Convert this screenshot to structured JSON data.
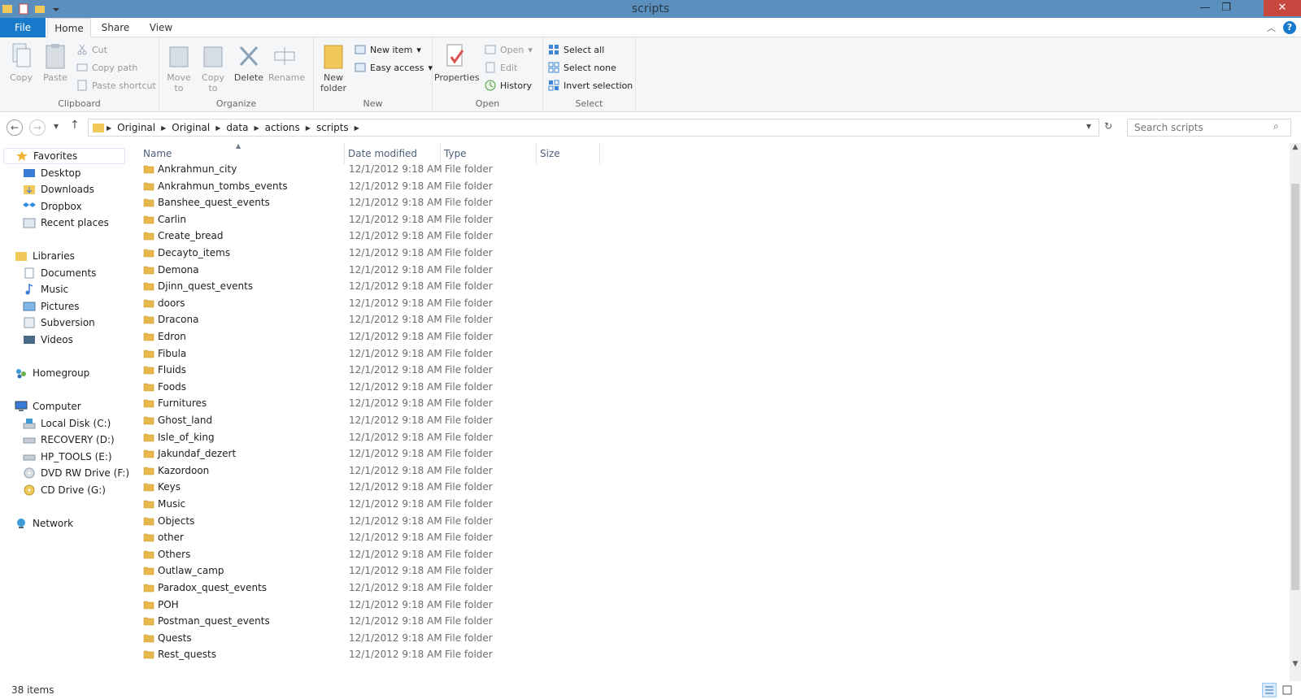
{
  "window": {
    "title": "scripts",
    "minimize": "—",
    "restore": "❐",
    "close": "✕"
  },
  "tabs": {
    "file": "File",
    "home": "Home",
    "share": "Share",
    "view": "View"
  },
  "ribbon": {
    "clipboard": {
      "name": "Clipboard",
      "copy": "Copy",
      "paste": "Paste",
      "cut": "Cut",
      "copy_path": "Copy path",
      "paste_shortcut": "Paste shortcut"
    },
    "organize": {
      "name": "Organize",
      "move_to": "Move to",
      "copy_to": "Copy to",
      "delete": "Delete",
      "rename": "Rename"
    },
    "new": {
      "name": "New",
      "new_folder": "New folder",
      "new_item": "New item",
      "easy_access": "Easy access"
    },
    "open": {
      "name": "Open",
      "properties": "Properties",
      "open": "Open",
      "edit": "Edit",
      "history": "History"
    },
    "select": {
      "name": "Select",
      "select_all": "Select all",
      "select_none": "Select none",
      "invert": "Invert selection"
    }
  },
  "address": {
    "breadcrumbs": [
      "Original",
      "Original",
      "data",
      "actions",
      "scripts"
    ],
    "search_placeholder": "Search scripts"
  },
  "nav": {
    "favorites": "Favorites",
    "favorites_items": [
      "Desktop",
      "Downloads",
      "Dropbox",
      "Recent places"
    ],
    "libraries": "Libraries",
    "libraries_items": [
      "Documents",
      "Music",
      "Pictures",
      "Subversion",
      "Videos"
    ],
    "homegroup": "Homegroup",
    "computer": "Computer",
    "computer_items": [
      "Local Disk (C:)",
      "RECOVERY (D:)",
      "HP_TOOLS (E:)",
      "DVD RW Drive (F:) W",
      "CD Drive (G:)"
    ],
    "network": "Network"
  },
  "columns": {
    "name": "Name",
    "date": "Date modified",
    "type": "Type",
    "size": "Size"
  },
  "files": [
    {
      "name": "Ankrahmun_city",
      "date": "12/1/2012 9:18 AM",
      "type": "File folder"
    },
    {
      "name": "Ankrahmun_tombs_events",
      "date": "12/1/2012 9:18 AM",
      "type": "File folder"
    },
    {
      "name": "Banshee_quest_events",
      "date": "12/1/2012 9:18 AM",
      "type": "File folder"
    },
    {
      "name": "Carlin",
      "date": "12/1/2012 9:18 AM",
      "type": "File folder"
    },
    {
      "name": "Create_bread",
      "date": "12/1/2012 9:18 AM",
      "type": "File folder"
    },
    {
      "name": "Decayto_items",
      "date": "12/1/2012 9:18 AM",
      "type": "File folder"
    },
    {
      "name": "Demona",
      "date": "12/1/2012 9:18 AM",
      "type": "File folder"
    },
    {
      "name": "Djinn_quest_events",
      "date": "12/1/2012 9:18 AM",
      "type": "File folder"
    },
    {
      "name": "doors",
      "date": "12/1/2012 9:18 AM",
      "type": "File folder"
    },
    {
      "name": "Dracona",
      "date": "12/1/2012 9:18 AM",
      "type": "File folder"
    },
    {
      "name": "Edron",
      "date": "12/1/2012 9:18 AM",
      "type": "File folder"
    },
    {
      "name": "Fibula",
      "date": "12/1/2012 9:18 AM",
      "type": "File folder"
    },
    {
      "name": "Fluids",
      "date": "12/1/2012 9:18 AM",
      "type": "File folder"
    },
    {
      "name": "Foods",
      "date": "12/1/2012 9:18 AM",
      "type": "File folder"
    },
    {
      "name": "Furnitures",
      "date": "12/1/2012 9:18 AM",
      "type": "File folder"
    },
    {
      "name": "Ghost_land",
      "date": "12/1/2012 9:18 AM",
      "type": "File folder"
    },
    {
      "name": "Isle_of_king",
      "date": "12/1/2012 9:18 AM",
      "type": "File folder"
    },
    {
      "name": "Jakundaf_dezert",
      "date": "12/1/2012 9:18 AM",
      "type": "File folder"
    },
    {
      "name": "Kazordoon",
      "date": "12/1/2012 9:18 AM",
      "type": "File folder"
    },
    {
      "name": "Keys",
      "date": "12/1/2012 9:18 AM",
      "type": "File folder"
    },
    {
      "name": "Music",
      "date": "12/1/2012 9:18 AM",
      "type": "File folder"
    },
    {
      "name": "Objects",
      "date": "12/1/2012 9:18 AM",
      "type": "File folder"
    },
    {
      "name": "other",
      "date": "12/1/2012 9:18 AM",
      "type": "File folder"
    },
    {
      "name": "Others",
      "date": "12/1/2012 9:18 AM",
      "type": "File folder"
    },
    {
      "name": "Outlaw_camp",
      "date": "12/1/2012 9:18 AM",
      "type": "File folder"
    },
    {
      "name": "Paradox_quest_events",
      "date": "12/1/2012 9:18 AM",
      "type": "File folder"
    },
    {
      "name": "POH",
      "date": "12/1/2012 9:18 AM",
      "type": "File folder"
    },
    {
      "name": "Postman_quest_events",
      "date": "12/1/2012 9:18 AM",
      "type": "File folder"
    },
    {
      "name": "Quests",
      "date": "12/1/2012 9:18 AM",
      "type": "File folder"
    },
    {
      "name": "Rest_quests",
      "date": "12/1/2012 9:18 AM",
      "type": "File folder"
    }
  ],
  "status": {
    "count": "38 items"
  },
  "colors": {
    "titlebar": "#5b8fbd",
    "file_tab": "#1979ca",
    "close": "#c7483e",
    "folder": "#e8b84a"
  }
}
